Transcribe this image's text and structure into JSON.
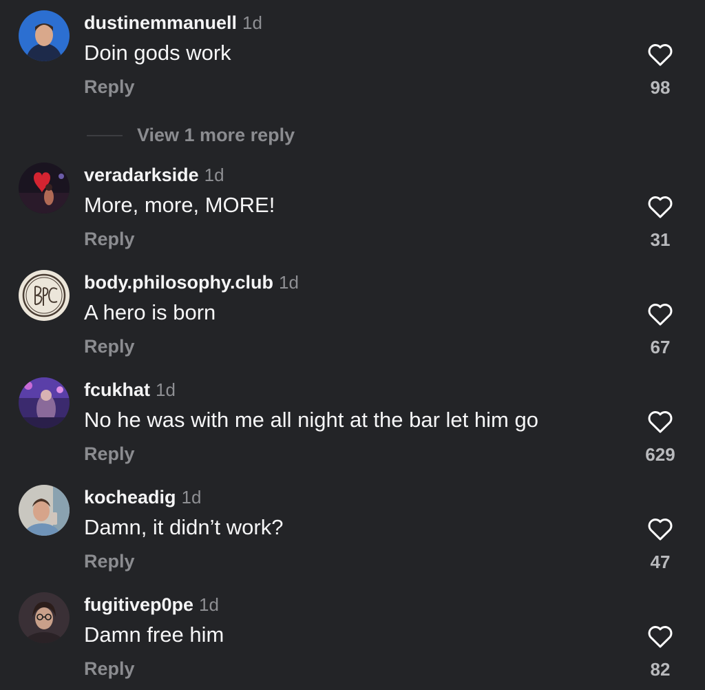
{
  "comments": [
    {
      "username": "dustinemmanuell",
      "time": "1d",
      "text": "Doin gods work",
      "reply_label": "Reply",
      "likes": "98",
      "view_more": "View 1 more reply",
      "avatar": "man-portrait-avatar"
    },
    {
      "username": "veradarkside",
      "time": "1d",
      "text": "More, more, MORE!",
      "reply_label": "Reply",
      "likes": "31",
      "avatar": "red-heart-concert-avatar"
    },
    {
      "username": "body.philosophy.club",
      "time": "1d",
      "text": "A hero is born",
      "reply_label": "Reply",
      "likes": "67",
      "avatar": "bpc-logo-avatar"
    },
    {
      "username": "fcukhat",
      "time": "1d",
      "text": "No he was with me all night at the bar let him go",
      "reply_label": "Reply",
      "likes": "629",
      "avatar": "purple-party-avatar"
    },
    {
      "username": "kocheadig",
      "time": "1d",
      "text": "Damn, it didn’t work?",
      "reply_label": "Reply",
      "likes": "47",
      "avatar": "selfie-avatar"
    },
    {
      "username": "fugitivep0pe",
      "time": "1d",
      "text": "Damn free him",
      "reply_label": "Reply",
      "likes": "82",
      "avatar": "glasses-portrait-avatar"
    }
  ],
  "colors": {
    "background": "#232427",
    "text": "#f4f4f5",
    "muted": "#8b8c90",
    "like_icon": "#ffffff"
  },
  "icons": {
    "like": "heart-outline-icon"
  }
}
